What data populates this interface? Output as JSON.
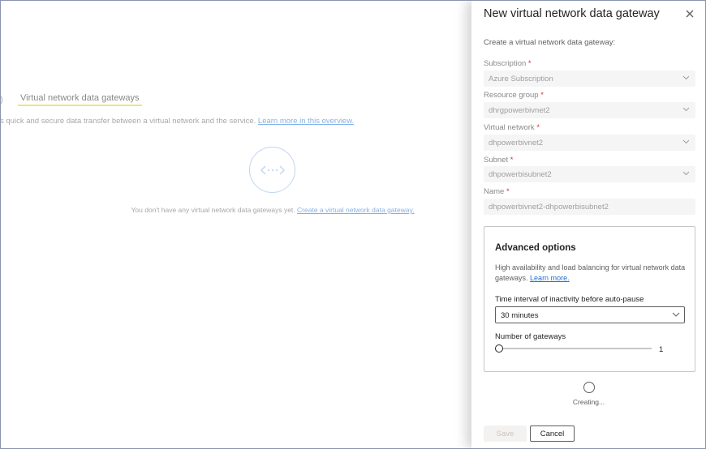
{
  "background": {
    "tab_previous_fragment": ")",
    "active_tab": "Virtual network data gateways",
    "description": "s quick and secure data transfer between a virtual network and the service.",
    "description_link": "Learn more in this overview.",
    "empty_text": "You don't have any virtual network data gateways yet.",
    "empty_link": "Create a virtual network data gateway."
  },
  "panel": {
    "title": "New virtual network data gateway",
    "intro": "Create a virtual network data gateway:",
    "fields": [
      {
        "label": "Subscription",
        "required": "*",
        "value": "Azure Subscription"
      },
      {
        "label": "Resource group",
        "required": "*",
        "value": "dhrgpowerbivnet2"
      },
      {
        "label": "Virtual network",
        "required": "*",
        "value": "dhpowerbivnet2"
      },
      {
        "label": "Subnet",
        "required": "*",
        "value": "dhpowerbisubnet2"
      },
      {
        "label": "Name",
        "required": "*",
        "value": "dhpowerbivnet2-dhpowerbisubnet2"
      }
    ],
    "advanced": {
      "title": "Advanced options",
      "description": "High availability and load balancing for virtual network data gateways.",
      "learn_more": "Learn more.",
      "interval_label": "Time interval of inactivity before auto-pause",
      "interval_value": "30 minutes",
      "gateways_label": "Number of gateways",
      "gateways_value": "1",
      "gateways_min": 1,
      "gateways_max": 9
    },
    "status": "Creating...",
    "save_label": "Save",
    "cancel_label": "Cancel"
  },
  "colors": {
    "accent_tab": "#e8c81a",
    "link": "#1f6fd1",
    "required": "#d13438"
  }
}
